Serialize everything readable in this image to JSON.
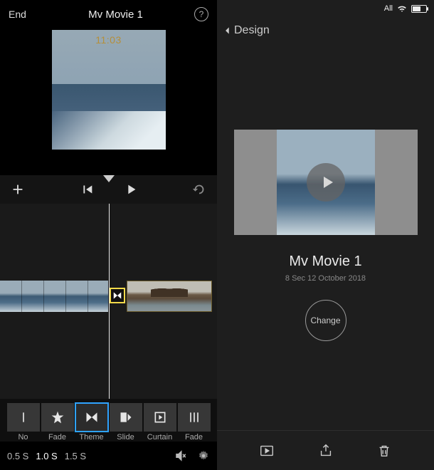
{
  "left": {
    "end_label": "End",
    "title": "Mv Movie 1",
    "timecode": "11:03",
    "durations": [
      "0.5 S",
      "1.0 S",
      "1.5 S"
    ],
    "active_duration_index": 1,
    "selected_transition_index": 2,
    "transitions": [
      {
        "id": "none",
        "label": "No"
      },
      {
        "id": "fade",
        "label": "Fade"
      },
      {
        "id": "theme",
        "label": "Theme"
      },
      {
        "id": "slide",
        "label": "Slide"
      },
      {
        "id": "curtain",
        "label": "Curtain"
      },
      {
        "id": "fade2",
        "label": "Fade"
      }
    ]
  },
  "right": {
    "status": {
      "carrier": "All"
    },
    "back_label": "Design",
    "movie_title": "Mv Movie 1",
    "movie_meta": "8 Sec 12 October 2018",
    "change_label": "Change"
  }
}
